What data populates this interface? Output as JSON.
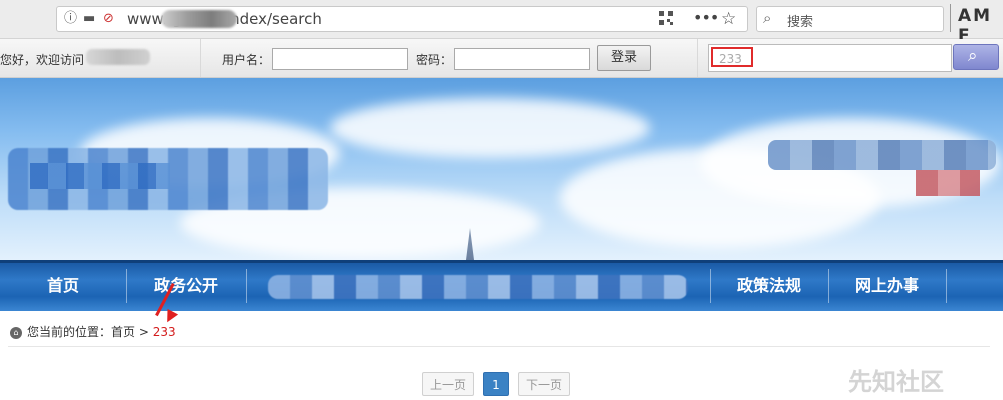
{
  "browser": {
    "url": "www.             gov.cn/index/search",
    "search_placeholder": "搜索",
    "corner_text": "AM F"
  },
  "topbar": {
    "welcome": "您好，欢迎访问",
    "username_label": "用户名：",
    "password_label": "密码：",
    "login_button": "登录",
    "search_value": "233"
  },
  "nav": {
    "items": [
      "首页",
      "政务公开",
      "政策法规",
      "网上办事"
    ]
  },
  "breadcrumb": {
    "prefix": "您当前的位置：首页",
    "separator": ">",
    "current": "233"
  },
  "pagination": {
    "prev": "上一页",
    "current": "1",
    "next": "下一页"
  },
  "watermark": "先知社区",
  "colors": {
    "nav_blue": "#2f79c8",
    "highlight_red": "#e02b2b",
    "page_active": "#3b82c4"
  }
}
